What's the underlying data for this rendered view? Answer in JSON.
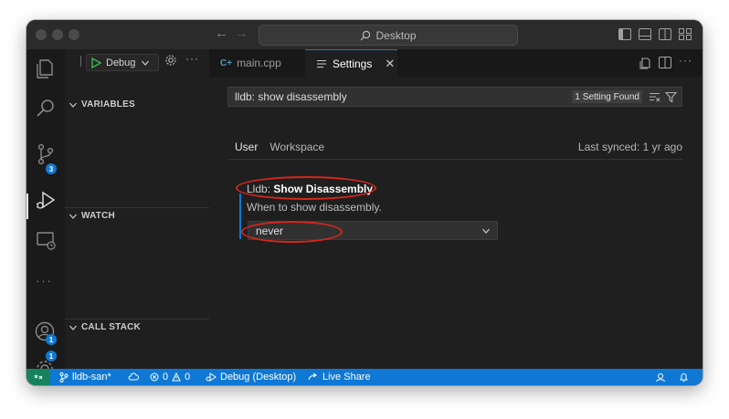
{
  "titlebar": {
    "search_text": "Desktop"
  },
  "activitybar": {
    "scm_badge": "3",
    "accounts_badge": "1",
    "manage_badge": "1",
    "more_label": "···"
  },
  "debug": {
    "config_label": "Debug"
  },
  "sidebar": {
    "sections": {
      "variables": "VARIABLES",
      "watch": "WATCH",
      "call_stack": "CALL STACK"
    }
  },
  "tabs": [
    {
      "label": "main.cpp",
      "icon": "c-plus-plus-file-icon"
    },
    {
      "label": "Settings",
      "icon": "settings-editor-icon"
    }
  ],
  "settings": {
    "search_value": "lldb: show disassembly",
    "result_count": "1 Setting Found",
    "scopes": [
      "User",
      "Workspace"
    ],
    "last_synced": "Last synced: 1 yr ago",
    "item": {
      "category": "Lldb: ",
      "name": "Show Disassembly",
      "description": "When to show disassembly.",
      "value": "never"
    }
  },
  "statusbar": {
    "branch": "lldb-san*",
    "errors": "0",
    "warnings": "0",
    "debug_config": "Debug (Desktop)",
    "live_share": "Live Share"
  },
  "colors": {
    "accent": "#0e78d4",
    "remote": "#16825d",
    "annotation": "#d5261c"
  }
}
